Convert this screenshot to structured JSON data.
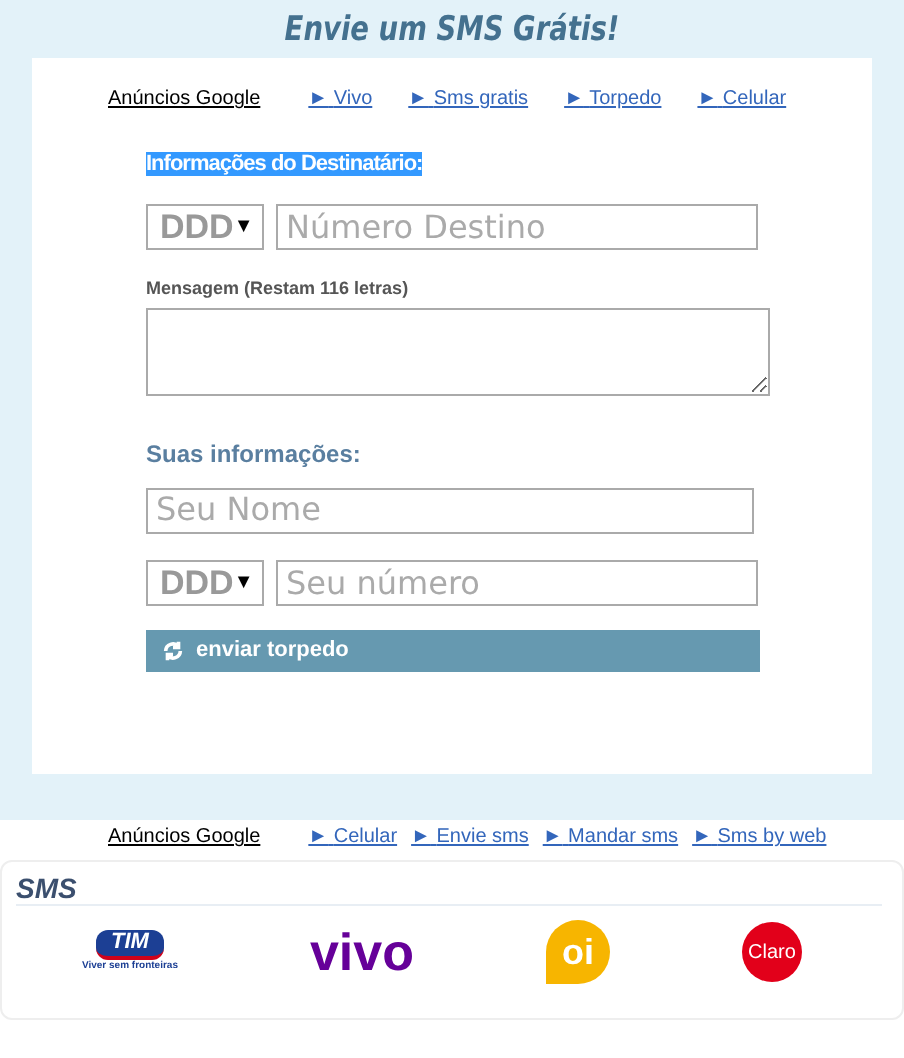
{
  "title": "Envie um SMS Grátis!",
  "ads_top": {
    "label": "Anúncios Google",
    "links": [
      {
        "arrow": "►",
        "text": "Vivo"
      },
      {
        "arrow": "►",
        "text": "Sms gratis"
      },
      {
        "arrow": "►",
        "text": "Torpedo"
      },
      {
        "arrow": "►",
        "text": "Celular"
      }
    ]
  },
  "recipient": {
    "heading": "Informações do Destinatário:",
    "ddd": {
      "value": "DDD",
      "arrow": "▼"
    },
    "number": {
      "placeholder": "Número Destino"
    }
  },
  "message": {
    "label": "Mensagem (Restam 116 letras)"
  },
  "sender": {
    "heading": "Suas informações:",
    "name": {
      "placeholder": "Seu Nome"
    },
    "ddd": {
      "value": "DDD",
      "arrow": "▼"
    },
    "number": {
      "placeholder": "Seu número"
    }
  },
  "submit": {
    "label": "enviar torpedo"
  },
  "ads_bottom": {
    "label": "Anúncios Google",
    "links": [
      {
        "arrow": "►",
        "text": "Celular"
      },
      {
        "arrow": "►",
        "text": "Envie sms"
      },
      {
        "arrow": "►",
        "text": "Mandar sms"
      },
      {
        "arrow": "►",
        "text": "Sms by web"
      }
    ]
  },
  "operators": {
    "heading": "SMS",
    "logos": [
      {
        "kind": "tim",
        "name": "TIM",
        "tagline": "Viver sem fronteiras"
      },
      {
        "kind": "vivo",
        "name": "vivo"
      },
      {
        "kind": "oi",
        "name": "oi"
      },
      {
        "kind": "claro",
        "name": "Claro"
      }
    ]
  }
}
